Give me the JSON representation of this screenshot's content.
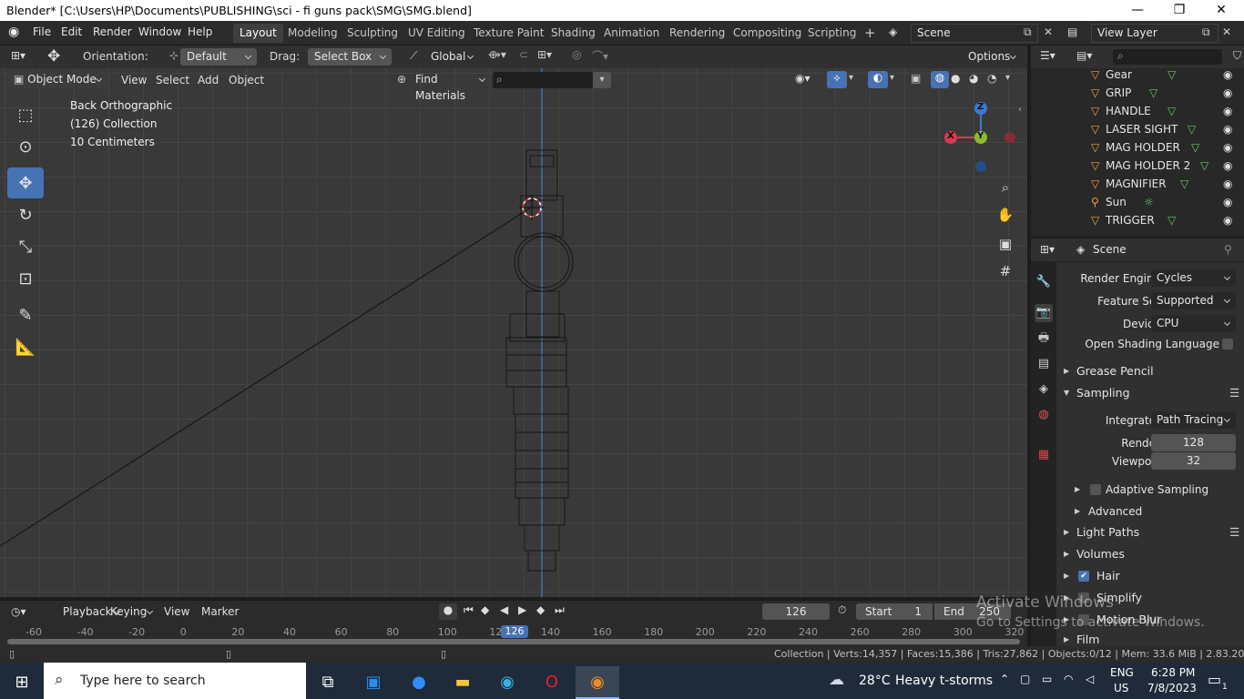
{
  "window": {
    "title": "Blender* [C:\\Users\\HP\\Documents\\PUBLISHING\\sci - fi guns pack\\SMG\\SMG.blend]",
    "minimize": "—",
    "maximize": "❐",
    "close": "✕"
  },
  "menubar": {
    "items": [
      "File",
      "Edit",
      "Render",
      "Window",
      "Help"
    ]
  },
  "workspaces": {
    "tabs": [
      "Layout",
      "Modeling",
      "Sculpting",
      "UV Editing",
      "Texture Paint",
      "Shading",
      "Animation",
      "Rendering",
      "Compositing",
      "Scripting"
    ],
    "active": "Layout",
    "add": "+"
  },
  "scene_field": "Scene",
  "viewlayer_field": "View Layer",
  "toolsettings": {
    "orientation_label": "Orientation:",
    "orientation_value": "Default",
    "drag_label": "Drag:",
    "drag_value": "Select Box",
    "transform_orientation": "Global",
    "options": "Options"
  },
  "viewport_header": {
    "mode": "Object Mode",
    "menus": [
      "View",
      "Select",
      "Add",
      "Object"
    ],
    "find_materials": "Find Materials"
  },
  "viewport_info": {
    "view": "Back Orthographic",
    "collection": "(126) Collection",
    "scale": "10 Centimeters"
  },
  "gizmo": {
    "x": "X",
    "y": "Y",
    "z": "Z"
  },
  "outliner": {
    "items": [
      {
        "name": "Gear",
        "icon": "mesh-icon"
      },
      {
        "name": "GRIP",
        "icon": "mesh-icon"
      },
      {
        "name": "HANDLE",
        "icon": "mesh-icon"
      },
      {
        "name": "LASER SIGHT",
        "icon": "mesh-icon"
      },
      {
        "name": "MAG HOLDER",
        "icon": "mesh-icon"
      },
      {
        "name": "MAG HOLDER 2",
        "icon": "mesh-icon"
      },
      {
        "name": "MAGNIFIER",
        "icon": "mesh-icon"
      },
      {
        "name": "Sun",
        "icon": "light-icon"
      },
      {
        "name": "TRIGGER",
        "icon": "mesh-icon"
      }
    ]
  },
  "properties": {
    "context": "Scene",
    "render_engine_label": "Render Engine",
    "render_engine": "Cycles",
    "feature_set_label": "Feature Set",
    "feature_set": "Supported",
    "device_label": "Device",
    "device": "CPU",
    "osl_label": "Open Shading Language",
    "sections": {
      "grease_pencil": "Grease Pencil",
      "sampling": "Sampling",
      "light_paths": "Light Paths",
      "volumes": "Volumes",
      "hair": "Hair",
      "simplify": "Simplify",
      "motion_blur": "Motion Blur",
      "film": "Film"
    },
    "integrator_label": "Integrator",
    "integrator": "Path Tracing",
    "render_label": "Render",
    "render_samples": "128",
    "viewport_label": "Viewport",
    "viewport_samples": "32",
    "adaptive_sampling": "Adaptive Sampling",
    "advanced": "Advanced"
  },
  "timeline": {
    "menus": [
      "Playback",
      "Keying",
      "View",
      "Marker"
    ],
    "current_frame": "126",
    "start_label": "Start",
    "start": "1",
    "end_label": "End",
    "end": "250",
    "ruler": [
      "-60",
      "-40",
      "-20",
      "0",
      "20",
      "40",
      "60",
      "80",
      "100",
      "120",
      "140",
      "160",
      "180",
      "200",
      "220",
      "240",
      "260",
      "280",
      "300",
      "320"
    ],
    "playhead": "126"
  },
  "statusbar": {
    "stats": "Collection | Verts:14,357 | Faces:15,386 | Tris:27,862 | Objects:0/12 | Mem: 33.6 MiB | 2.83.20"
  },
  "activation": {
    "line1": "Activate Windows",
    "line2": "Go to Settings to activate Windows."
  },
  "taskbar": {
    "search_placeholder": "Type here to search",
    "weather_temp": "28°C",
    "weather_desc": "Heavy t-storms",
    "lang1": "ENG",
    "lang2": "US",
    "time": "6:28 PM",
    "date": "7/8/2023",
    "notifications": "1"
  },
  "colors": {
    "accent": "#4772b3",
    "object_orange": "#f0a040",
    "axis_x": "#d6394e",
    "axis_y": "#8cbb2a",
    "axis_z": "#3a7ad0"
  }
}
